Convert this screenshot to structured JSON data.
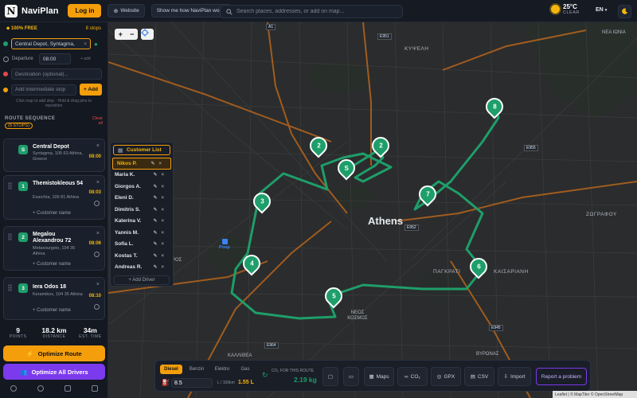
{
  "header": {
    "app_name": "NaviPlan",
    "login_label": "Log in",
    "website_label": "Website",
    "howto_label": "Show me how NaviPlan works",
    "search_placeholder": "Search places, addresses, or add on map...",
    "weather_temp": "25°C",
    "weather_desc": "CLEAR",
    "language": "EN"
  },
  "sidebar": {
    "plan_label": "100% FREE",
    "stops_label": "8 stops",
    "start_value": "Central Depot, Syntagma,",
    "departure_label": "Departure",
    "departure_time": "08:00",
    "departure_extra": "+ add",
    "destination_placeholder": "Destination (optional)...",
    "intermediate_placeholder": "Add intermediate stop",
    "add_label": "+ Add",
    "hint": "Click map to add stop · Hold & drag pins to reposition",
    "route_title": "ROUTE SEQUENCE",
    "route_badge": "(8 STOPS)",
    "clear_all": "Clear all",
    "stops": [
      {
        "num": "S",
        "name": "Central Depot",
        "addr": "Syntagma, 105 63 Athina, Greece",
        "time": "08:00",
        "cust": ""
      },
      {
        "num": "1",
        "name": "Themistokleous 54",
        "addr": "Exarchia, 106 81 Athina",
        "time": "08:03",
        "cust": "+ Customer name"
      },
      {
        "num": "2",
        "name": "Megalou Alexandrou 72",
        "addr": "Metaxourgeio, 104 35 Athina",
        "time": "08:06",
        "cust": "+ Customer name"
      },
      {
        "num": "3",
        "name": "Iera Odos 18",
        "addr": "Keramikos, 104 35 Athina",
        "time": "08:10",
        "cust": "+ Customer name"
      }
    ],
    "stats": [
      {
        "value": "9",
        "label": "POINTS"
      },
      {
        "value": "18.2 km",
        "label": "DISTANCE"
      },
      {
        "value": "34m",
        "label": "EST. TIME"
      }
    ],
    "optimize_label": "Optimize Route",
    "optimize_all_label": "Optimize All Drivers"
  },
  "map": {
    "city_label": "Athens",
    "areas": [
      "ΚΥΨΕΛΗ",
      "ΠΑΓΚΡΑΤΙ",
      "ΖΩΓΡΑΦΟΥ",
      "ΚΑΙΣΑΡΙΑΝΗ",
      "ΝΕΟΣ ΚΟΣΜΟΣ",
      "ΚΑΛΛΙΘΕΑ",
      "ΒΥΡΩΝΑΣ",
      "ΝΕΑ ΙΩΝΙΑ",
      "ΒΥΡΟΣ",
      "ΝΕΟ ΨΥΧΙΚΟ"
    ],
    "road_labels": [
      "A1",
      "E951",
      "E875",
      "E952",
      "E954",
      "E955",
      "E962",
      "E964",
      "E97",
      "E945",
      "E956",
      "E91",
      "E75"
    ],
    "metro_label": "Poop",
    "pins": [
      "S",
      "2",
      "3",
      "4",
      "5",
      "6",
      "7",
      "8",
      "2"
    ]
  },
  "customer_list": {
    "title": "Customer List",
    "items": [
      "Nikos P.",
      "Maria K.",
      "Giorgos A.",
      "Eleni D.",
      "Dimitris S.",
      "Katerina V.",
      "Yannis M.",
      "Sofia L.",
      "Kostas T.",
      "Andreas R."
    ],
    "selected": "Nikos P.",
    "add_driver": "+ Add Driver"
  },
  "toolbar": {
    "fuel_tabs": [
      "Diesel",
      "Benzin",
      "Elektro",
      "Gas"
    ],
    "active_fuel": "Diesel",
    "consumption": "8.5",
    "consumption_unit": "L / 100km",
    "fuel_total": "1.55 L",
    "co2_label": "CO₂ FOR THIS ROUTE",
    "co2_value": "2.19 kg",
    "buttons": [
      "Maps",
      "CO₂",
      "GPX",
      "CSV",
      "Import"
    ],
    "report_label": "Report a problem"
  },
  "attribution": "Leaflet | © MapTiler © OpenStreetMap",
  "colors": {
    "accent": "#f59e0b",
    "route": "#1e9e6a",
    "purple": "#7c3aed",
    "bg": "#131821"
  }
}
